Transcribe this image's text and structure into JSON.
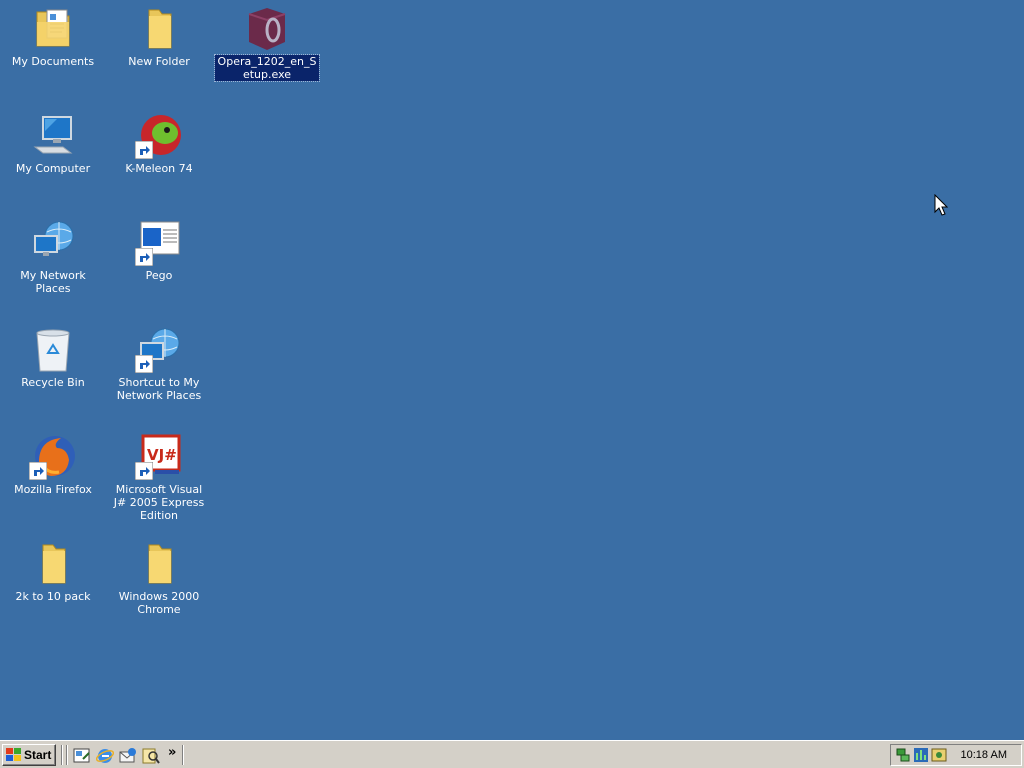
{
  "desktop": {
    "icons": [
      {
        "label": "My Documents"
      },
      {
        "label": "New Folder"
      },
      {
        "label": "Opera_1202_en_Setup.exe",
        "selected": true
      },
      {
        "label": "My Computer"
      },
      {
        "label": "K-Meleon 74"
      },
      {
        "label": "My Network Places"
      },
      {
        "label": "Pego"
      },
      {
        "label": "Recycle Bin"
      },
      {
        "label": "Shortcut to My Network Places"
      },
      {
        "label": "Mozilla Firefox"
      },
      {
        "label": "Microsoft Visual J# 2005 Express Edition"
      },
      {
        "label": "2k to 10 pack"
      },
      {
        "label": "Windows 2000 Chrome"
      }
    ],
    "background_color": "#3a6ea5"
  },
  "taskbar": {
    "start_label": "Start",
    "quick_launch": [
      "show-desktop-icon",
      "internet-explorer-icon",
      "outlook-express-icon",
      "search-icon"
    ],
    "clock": "10:18 AM"
  }
}
